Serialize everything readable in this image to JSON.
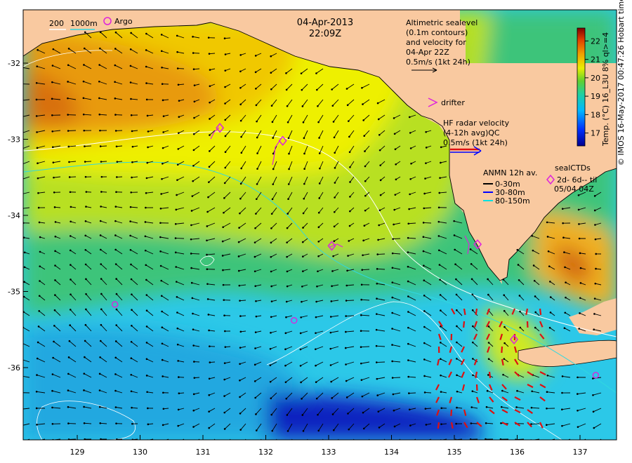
{
  "map": {
    "date": "04-Apr-2013",
    "time": "22:09Z"
  },
  "axes": {
    "x_ticks": [
      "129",
      "130",
      "131",
      "132",
      "133",
      "134",
      "135",
      "136",
      "137"
    ],
    "y_ticks": [
      "-32",
      "-33",
      "-34",
      "-35",
      "-36"
    ]
  },
  "legend": {
    "isobath_labels": [
      "200",
      "1000m"
    ],
    "argo_label": "Argo",
    "altimetry": [
      "Altimetric sealevel",
      "(0.1m contours)",
      "and velocity for",
      "04-Apr 22Z",
      "0.5m/s (1kt 24h)"
    ],
    "drifter_label": "drifter",
    "hf_radar": [
      "HF radar velocity",
      "(4-12h avg)QC",
      "0.5m/s (1kt 24h)"
    ],
    "anmn_title": "ANMN 12h av.",
    "anmn_items": [
      {
        "label": "0-30m",
        "color": "#000000"
      },
      {
        "label": "30-80m",
        "color": "#0000ff"
      },
      {
        "label": "80-150m",
        "color": "#00e0e0"
      }
    ],
    "seal_title": "sealCTDs",
    "seal_line1": "2d- 6d-- til",
    "seal_line2": "05/04 04Z"
  },
  "colorbar": {
    "title": "Temp. (°C) 16_L3U 8% ql>=4",
    "ticks": [
      "17",
      "18",
      "19",
      "20",
      "21",
      "22"
    ],
    "range": [
      16.3,
      22.7
    ]
  },
  "credit": "© IMOS 16-May-2017 00:47:26 Hobart time",
  "colors": {
    "land": "#f9c9a0",
    "arrow": "#000000",
    "argo": "#dd22dd",
    "hf_radar": "#dd1111",
    "contour": "#ffffff"
  },
  "argo_floats": [
    {
      "lon": 129.6,
      "lat": -35.17
    },
    {
      "lon": 132.45,
      "lat": -35.38
    },
    {
      "lon": 137.25,
      "lat": -36.1
    }
  ],
  "seal_ctds": [
    {
      "lon": 131.27,
      "lat": -32.85
    },
    {
      "lon": 132.27,
      "lat": -33.02
    },
    {
      "lon": 133.05,
      "lat": -34.4
    },
    {
      "lon": 135.37,
      "lat": -34.38
    },
    {
      "lon": 135.95,
      "lat": -35.63
    }
  ]
}
